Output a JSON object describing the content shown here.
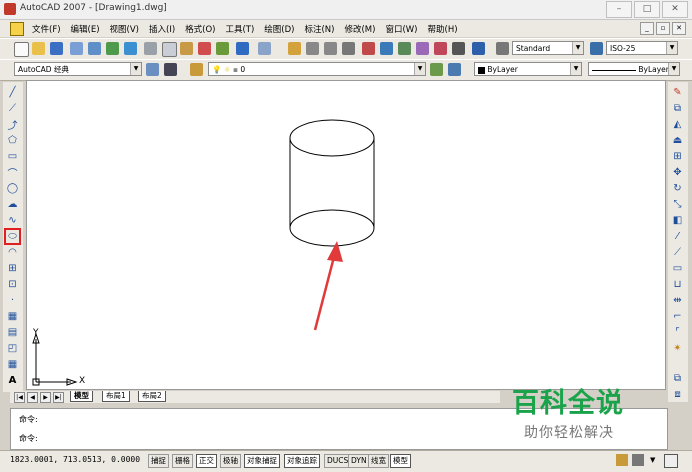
{
  "window": {
    "title": "AutoCAD 2007 - [Drawing1.dwg]",
    "controls": [
      "–",
      "□",
      "✕"
    ]
  },
  "menubar": {
    "items": [
      "文件(F)",
      "编辑(E)",
      "视图(V)",
      "插入(I)",
      "格式(O)",
      "工具(T)",
      "绘图(D)",
      "标注(N)",
      "修改(M)",
      "窗口(W)",
      "帮助(H)"
    ],
    "doc_controls": [
      "_",
      "▫",
      "✕"
    ]
  },
  "toolbar1": {
    "text_style": "Standard",
    "dim_style": "ISO-25"
  },
  "toolbar2": {
    "workspace": "AutoCAD 经典",
    "layer": "0",
    "color": "ByLayer",
    "linetype": "ByLayer"
  },
  "ucs": {
    "x_label": "X",
    "y_label": "Y"
  },
  "tabs": [
    "模型",
    "布局1",
    "布局2"
  ],
  "command": {
    "line1": "命令:",
    "line2": "命令:"
  },
  "status": {
    "coords": "1823.0001, 713.0513, 0.0000",
    "toggles": [
      "捕捉",
      "栅格",
      "正交",
      "极轴",
      "对象捕捉",
      "对象追踪",
      "DUCS",
      "DYN",
      "线宽",
      "模型"
    ]
  },
  "watermark": {
    "line1": "百科全说",
    "line2": "助你轻松解决"
  },
  "colors": {
    "annotation_arrow": "#e03a3a",
    "watermark_green": "#1aa34a"
  }
}
